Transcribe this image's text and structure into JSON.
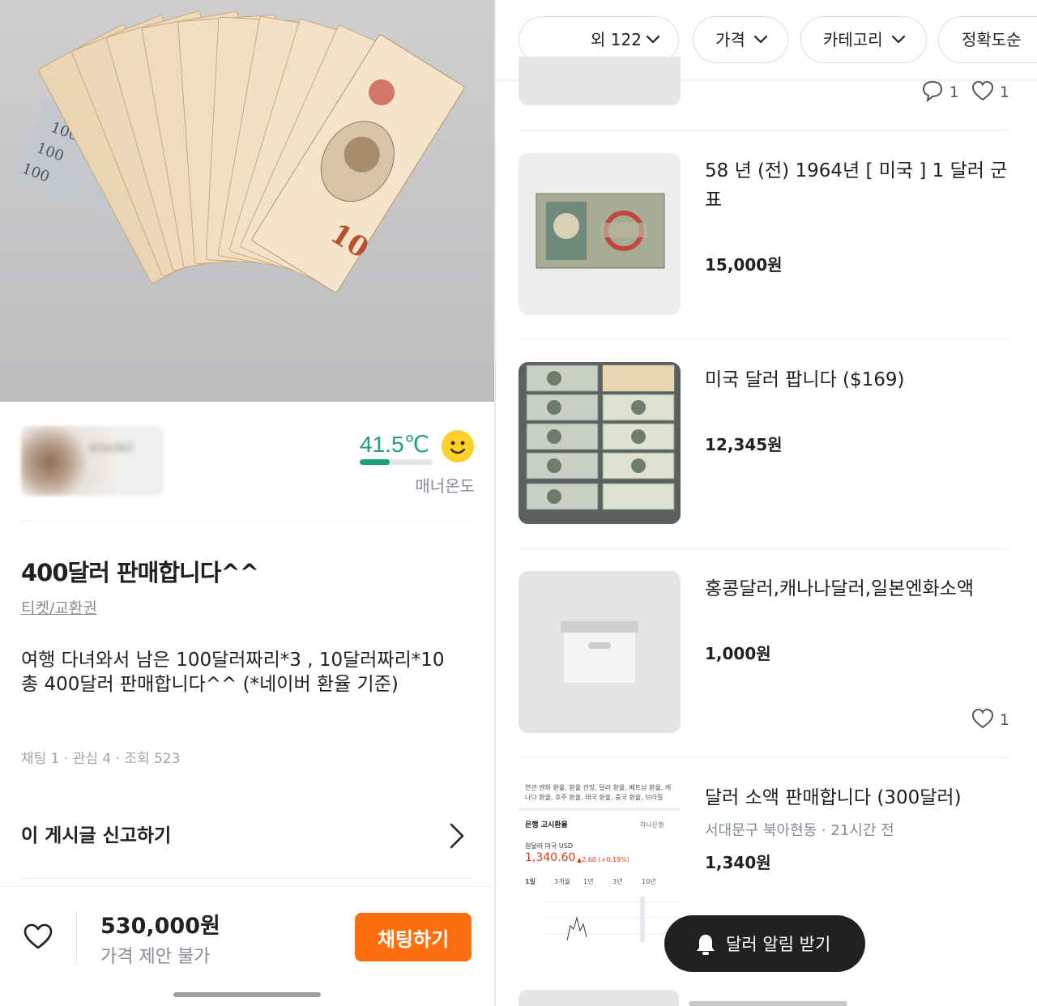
{
  "detail": {
    "temperature": "41.5℃",
    "temperature_level": 0.415,
    "temperature_label": "매너온도",
    "seller_name": "eledel",
    "title": "400달러 판매합니다^^",
    "category": "티켓/교환권",
    "description_line1": "여행 다녀와서 남은 100달러짜리*3 , 10달러짜리*10",
    "description_line2": "총 400달러 판매합니다^^ (*네이버 환율 기준)",
    "stats": "채팅 1 · 관심 4 · 조회 523",
    "report_label": "이 게시글 신고하기",
    "price": "530,000원",
    "negotiation": "가격 제안 불가",
    "chat_button": "채팅하기"
  },
  "filters": {
    "region": "외 122",
    "price": "가격",
    "category": "카테고리",
    "sort": "정확도순"
  },
  "list": {
    "top_partial": {
      "chat_count": "1",
      "like_count": "1"
    },
    "items": [
      {
        "title": "58 년 (전) 1964년 [ 미국 ] 1 달러 군표",
        "price": "15,000원"
      },
      {
        "title": "미국 달러 팝니다 ($169)",
        "price": "12,345원"
      },
      {
        "title": "홍콩달러,캐나나달러,일본엔화소액",
        "price": "1,000원",
        "like_count": "1"
      },
      {
        "title": "달러 소액 판매합니다 (300달러)",
        "subtitle": "서대문구 북아현동 · 21시간 전",
        "price": "1,340원"
      }
    ]
  },
  "screenshot_thumb": {
    "tabs_line1": "연관  엔화 환율, 환율 전망, 달러 환율, 베트남 환율, 캐",
    "tabs_line2": "나다 환율, 호주 환율, 태국 환율, 중국 환율, 브라질",
    "section": "은행 고시환율",
    "bank": "하나은행",
    "currency": "원달러  미국 USD",
    "rate": "1,340.60",
    "change": "▲2.60 (+0.19%)",
    "ranges": [
      "1일",
      "3개월",
      "1년",
      "3년",
      "10년"
    ]
  },
  "alarm_button": "달러 알림 받기",
  "colors": {
    "accent": "#ff6f0f",
    "manner_green": "#1aa174"
  }
}
